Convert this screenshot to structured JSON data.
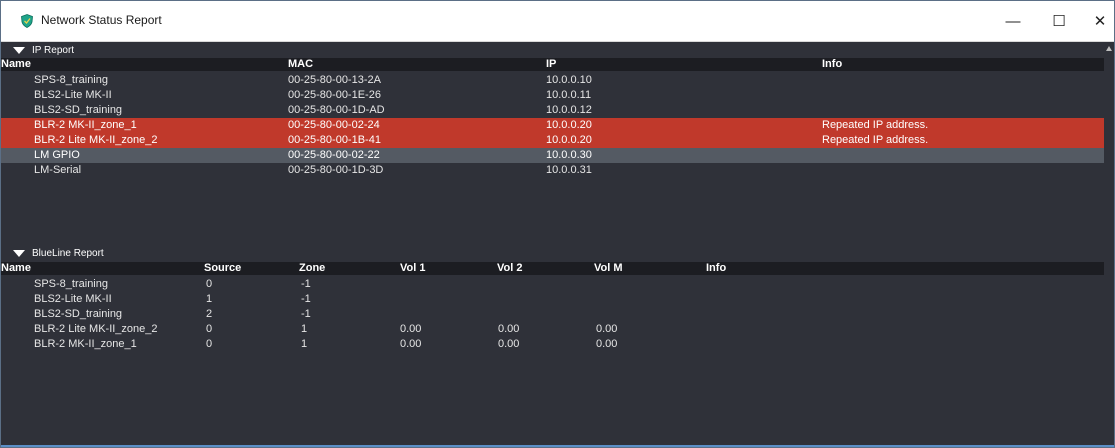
{
  "window": {
    "title": "Network Status Report",
    "minimize_glyph": "—",
    "maximize_glyph": "☐",
    "close_glyph": "✕",
    "icon": "shield-app-icon"
  },
  "ip_report": {
    "section_label": "IP Report",
    "columns": [
      "Name",
      "MAC",
      "IP",
      "Info"
    ],
    "rows": [
      {
        "name": "SPS-8_training",
        "mac": "00-25-80-00-13-2A",
        "ip": "10.0.0.10",
        "info": "",
        "state": "normal"
      },
      {
        "name": "BLS2-Lite MK-II",
        "mac": "00-25-80-00-1E-26",
        "ip": "10.0.0.11",
        "info": "",
        "state": "normal"
      },
      {
        "name": "BLS2-SD_training",
        "mac": "00-25-80-00-1D-AD",
        "ip": "10.0.0.12",
        "info": "",
        "state": "normal"
      },
      {
        "name": "BLR-2 MK-II_zone_1",
        "mac": "00-25-80-00-02-24",
        "ip": "10.0.0.20",
        "info": "Repeated IP address.",
        "state": "error"
      },
      {
        "name": "BLR-2 Lite MK-II_zone_2",
        "mac": "00-25-80-00-1B-41",
        "ip": "10.0.0.20",
        "info": "Repeated IP address.",
        "state": "error"
      },
      {
        "name": "LM GPIO",
        "mac": "00-25-80-00-02-22",
        "ip": "10.0.0.30",
        "info": "",
        "state": "selected"
      },
      {
        "name": "LM-Serial",
        "mac": "00-25-80-00-1D-3D",
        "ip": "10.0.0.31",
        "info": "",
        "state": "normal"
      }
    ]
  },
  "blueline_report": {
    "section_label": "BlueLine Report",
    "columns": [
      "Name",
      "Source",
      "Zone",
      "Vol 1",
      "Vol 2",
      "Vol M",
      "Info"
    ],
    "rows": [
      {
        "name": "SPS-8_training",
        "source": "0",
        "zone": "-1",
        "vol1": "",
        "vol2": "",
        "volm": "",
        "info": ""
      },
      {
        "name": "BLS2-Lite MK-II",
        "source": "1",
        "zone": "-1",
        "vol1": "",
        "vol2": "",
        "volm": "",
        "info": ""
      },
      {
        "name": "BLS2-SD_training",
        "source": "2",
        "zone": "-1",
        "vol1": "",
        "vol2": "",
        "volm": "",
        "info": ""
      },
      {
        "name": "BLR-2 Lite MK-II_zone_2",
        "source": "0",
        "zone": "1",
        "vol1": "0.00",
        "vol2": "0.00",
        "volm": "0.00",
        "info": ""
      },
      {
        "name": "BLR-2 MK-II_zone_1",
        "source": "0",
        "zone": "1",
        "vol1": "0.00",
        "vol2": "0.00",
        "volm": "0.00",
        "info": ""
      }
    ]
  },
  "colors": {
    "background": "#2f3139",
    "header": "#1c1d22",
    "error_row": "#c0392b",
    "selected_row": "#545a63",
    "text": "#e6e6e6"
  }
}
